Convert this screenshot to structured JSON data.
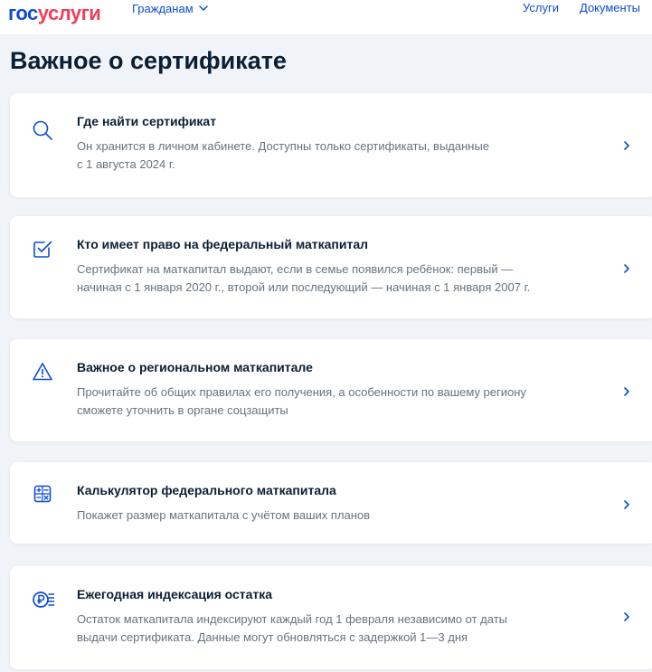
{
  "header": {
    "logo_part1": "гос",
    "logo_part2": "услуги",
    "citizens_label": "Гражданам",
    "nav": {
      "services": "Услуги",
      "documents": "Документы"
    }
  },
  "page": {
    "title": "Важное о сертификате"
  },
  "colors": {
    "brand_blue": "#0d4cd3",
    "brand_red": "#ee3f58",
    "text_primary": "#0b1f33",
    "text_secondary": "#66727f",
    "background": "#f0f4f8"
  },
  "cards": [
    {
      "icon": "search-icon",
      "title": "Где найти сертификат",
      "desc_line1": "Он хранится в личном кабинете. Доступны только сертификаты, выданные",
      "desc_line2": "с 1 августа 2024 г."
    },
    {
      "icon": "checkbox-icon",
      "title": "Кто имеет право на федеральный маткапитал",
      "desc_line1": "Сертификат на маткапитал выдают, если в семье появился ребёнок: первый —",
      "desc_line2": "начиная с 1 января 2020 г., второй или последующий — начиная с 1 января 2007 г."
    },
    {
      "icon": "warning-icon",
      "title": "Важное о региональном маткапитале",
      "desc_line1": "Прочитайте об общих правилах его получения, а особенности по вашему региону",
      "desc_line2": "сможете уточнить в органе соцзащиты"
    },
    {
      "icon": "calculator-icon",
      "title": "Калькулятор федерального маткапитала",
      "desc_line1": "Покажет размер маткапитала с учётом ваших планов",
      "desc_line2": ""
    },
    {
      "icon": "ruble-index-icon",
      "title": "Ежегодная индексация остатка",
      "desc_line1": "Остаток маткапитала индексируют каждый год 1 февраля независимо от даты",
      "desc_line2": "выдачи сертификата. Данные могут обновляться с задержкой 1—3 дня"
    }
  ]
}
